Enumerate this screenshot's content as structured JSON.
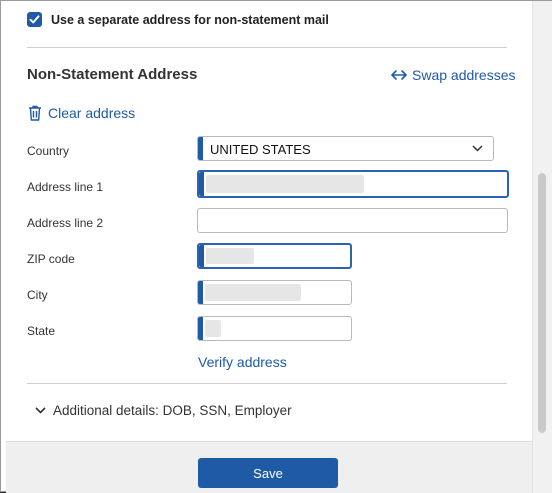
{
  "checkbox": {
    "label": "Use a separate address for non-statement mail",
    "checked": true
  },
  "section": {
    "title": "Non-Statement Address"
  },
  "actions": {
    "swap_label": "Swap addresses",
    "clear_label": "Clear address",
    "verify_label": "Verify address"
  },
  "form": {
    "country": {
      "label": "Country",
      "value": "UNITED STATES"
    },
    "address1": {
      "label": "Address line 1"
    },
    "address2": {
      "label": "Address line 2"
    },
    "zip": {
      "label": "ZIP code"
    },
    "city": {
      "label": "City"
    },
    "state": {
      "label": "State"
    }
  },
  "details": {
    "label": "Additional details: DOB, SSN, Employer"
  },
  "footer": {
    "save_label": "Save"
  },
  "colors": {
    "accent": "#1f5aa6",
    "link": "#1e5aa8"
  }
}
